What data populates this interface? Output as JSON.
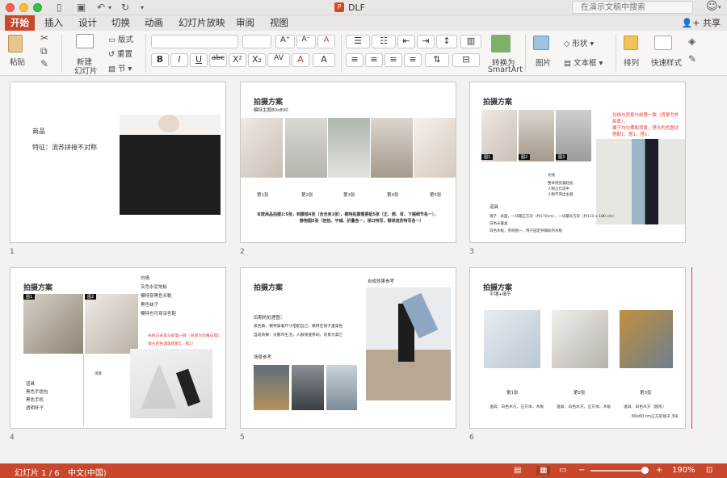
{
  "window": {
    "title": "DLF",
    "search_placeholder": "在演示文稿中搜索",
    "share": "共享"
  },
  "tabs": [
    "开始",
    "插入",
    "设计",
    "切换",
    "动画",
    "幻灯片放映",
    "审阅",
    "视图"
  ],
  "ribbon": {
    "paste": "粘贴",
    "new_slide_1": "新建",
    "new_slide_2": "幻灯片",
    "layout": "版式",
    "reset": "重置",
    "section": "节",
    "convert_1": "转换为",
    "convert_2": "SmartArt",
    "picture": "图片",
    "shape": "形状",
    "textbox": "文本框",
    "arrange": "排列",
    "quick_style": "快速样式"
  },
  "slides": [
    {
      "num": "1",
      "line1": "商品",
      "line2": "特征：流苏拼接不对称"
    },
    {
      "num": "2",
      "title": "拍摄方案",
      "subtitle": "模特主题80x800",
      "labels": [
        "第1张",
        "第2张",
        "第3张",
        "第4张",
        "第5张"
      ],
      "note1": "本款商品拍摄1:5张，到腰部4张（含全身1张），模特拍摄需要配5张（正、侧、背、下摆细节各一），",
      "note2": "静物图5张（挂拍、平铺、折叠各一，领口特写，侧领流苏特写各一）"
    },
    {
      "num": "3",
      "title": "拍摄方案",
      "red1": "光线与背景与前第一款（背景为外拍景），",
      "red2": "摄于均匀柔和背景，搭头的色图式搭配1，搭1，搭1，",
      "badges": [
        "图1",
        "图2",
        "图3"
      ],
      "small": [
        "光线",
        "整体感觉偏轻松",
        "人物占比适中",
        "人物不突出主题"
      ],
      "bottom1": "道具",
      "bottom2": "镜子：表面，一块最正方形（约170cm），一块最长方形（约110 x 180 cm）",
      "bottom3": "白色长餐桌",
      "bottom4": "白色木板，参照图一，用于固定并辅助的木板"
    },
    {
      "num": "4",
      "title": "拍摄方案",
      "list": [
        "白墙",
        "灰色水泥地板",
        "模特穿黑色长靴",
        "黑色袜子",
        "模特也可穿深色鞋"
      ],
      "badges": [
        "图1",
        "图2"
      ],
      "red1": "光线与背景与前第一款（背景为均每白墙），",
      "red2": "镜头的色调黑搭配1，搭2）",
      "small": "场景",
      "bottom": [
        "道具",
        "黑色手提包",
        "黑色手机",
        "透明杯子"
      ]
    },
    {
      "num": "5",
      "title": "拍摄方案",
      "ref": "自成效果参考",
      "lines": [
        "后期的处理图：",
        "黑色数，模特穿着尺寸搭配自己，模特在镜子里穿色",
        "自成效果：天都市生活，人群快速移动，背景为其它"
      ],
      "ref2": "场景参考"
    },
    {
      "num": "6",
      "title": "拍摄方案",
      "subtitle": "平铺+细节",
      "labels": [
        "第1张",
        "第2张",
        "第3张"
      ],
      "props": [
        "道具：白色木方，正方体，木板",
        "道具：白色木方，正方体，木板",
        "道具：白色木方（圆形）"
      ],
      "size": "60x60 cm正方形镜子 3块"
    }
  ],
  "status": {
    "slide": "幻灯片 1 / 6",
    "lang": "中文(中国)",
    "zoom": "190%",
    "minus": "−",
    "plus": "+"
  },
  "colors": {
    "accent": "#c9472b"
  }
}
